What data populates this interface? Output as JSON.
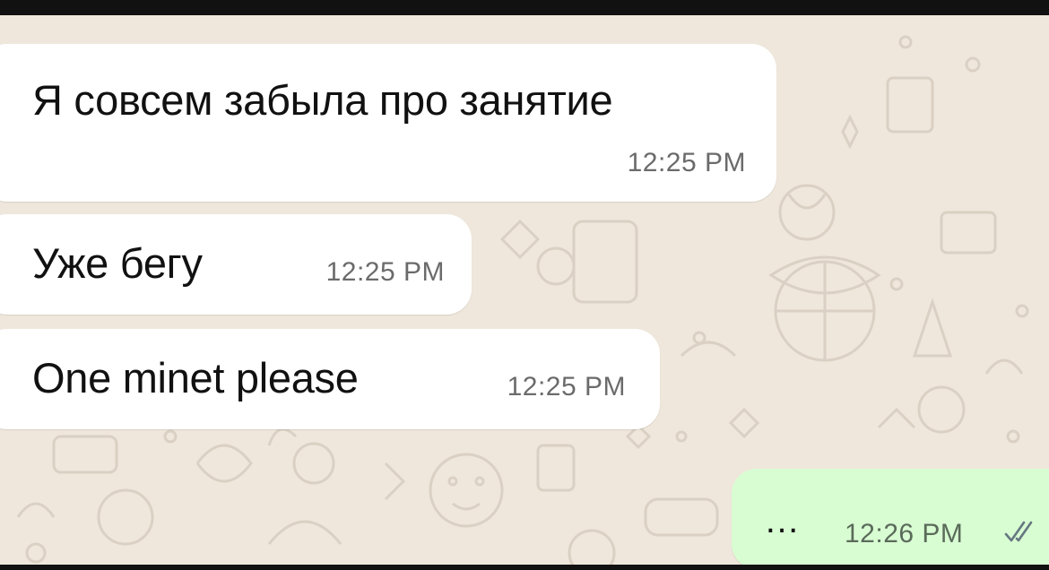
{
  "messages": [
    {
      "direction": "incoming",
      "text": "Я совсем забыла про занятие",
      "time": "12:25 PM"
    },
    {
      "direction": "incoming",
      "text": "Уже бегу",
      "time": "12:25 PM"
    },
    {
      "direction": "incoming",
      "text": "One minet please",
      "time": "12:25 PM"
    },
    {
      "direction": "outgoing",
      "text": "…",
      "time": "12:26 PM",
      "status_icon": "double-check-icon"
    }
  ],
  "colors": {
    "chat_background": "#efe7dc",
    "incoming_bubble": "#ffffff",
    "outgoing_bubble": "#d9fdd3",
    "tick_color": "#667781"
  }
}
